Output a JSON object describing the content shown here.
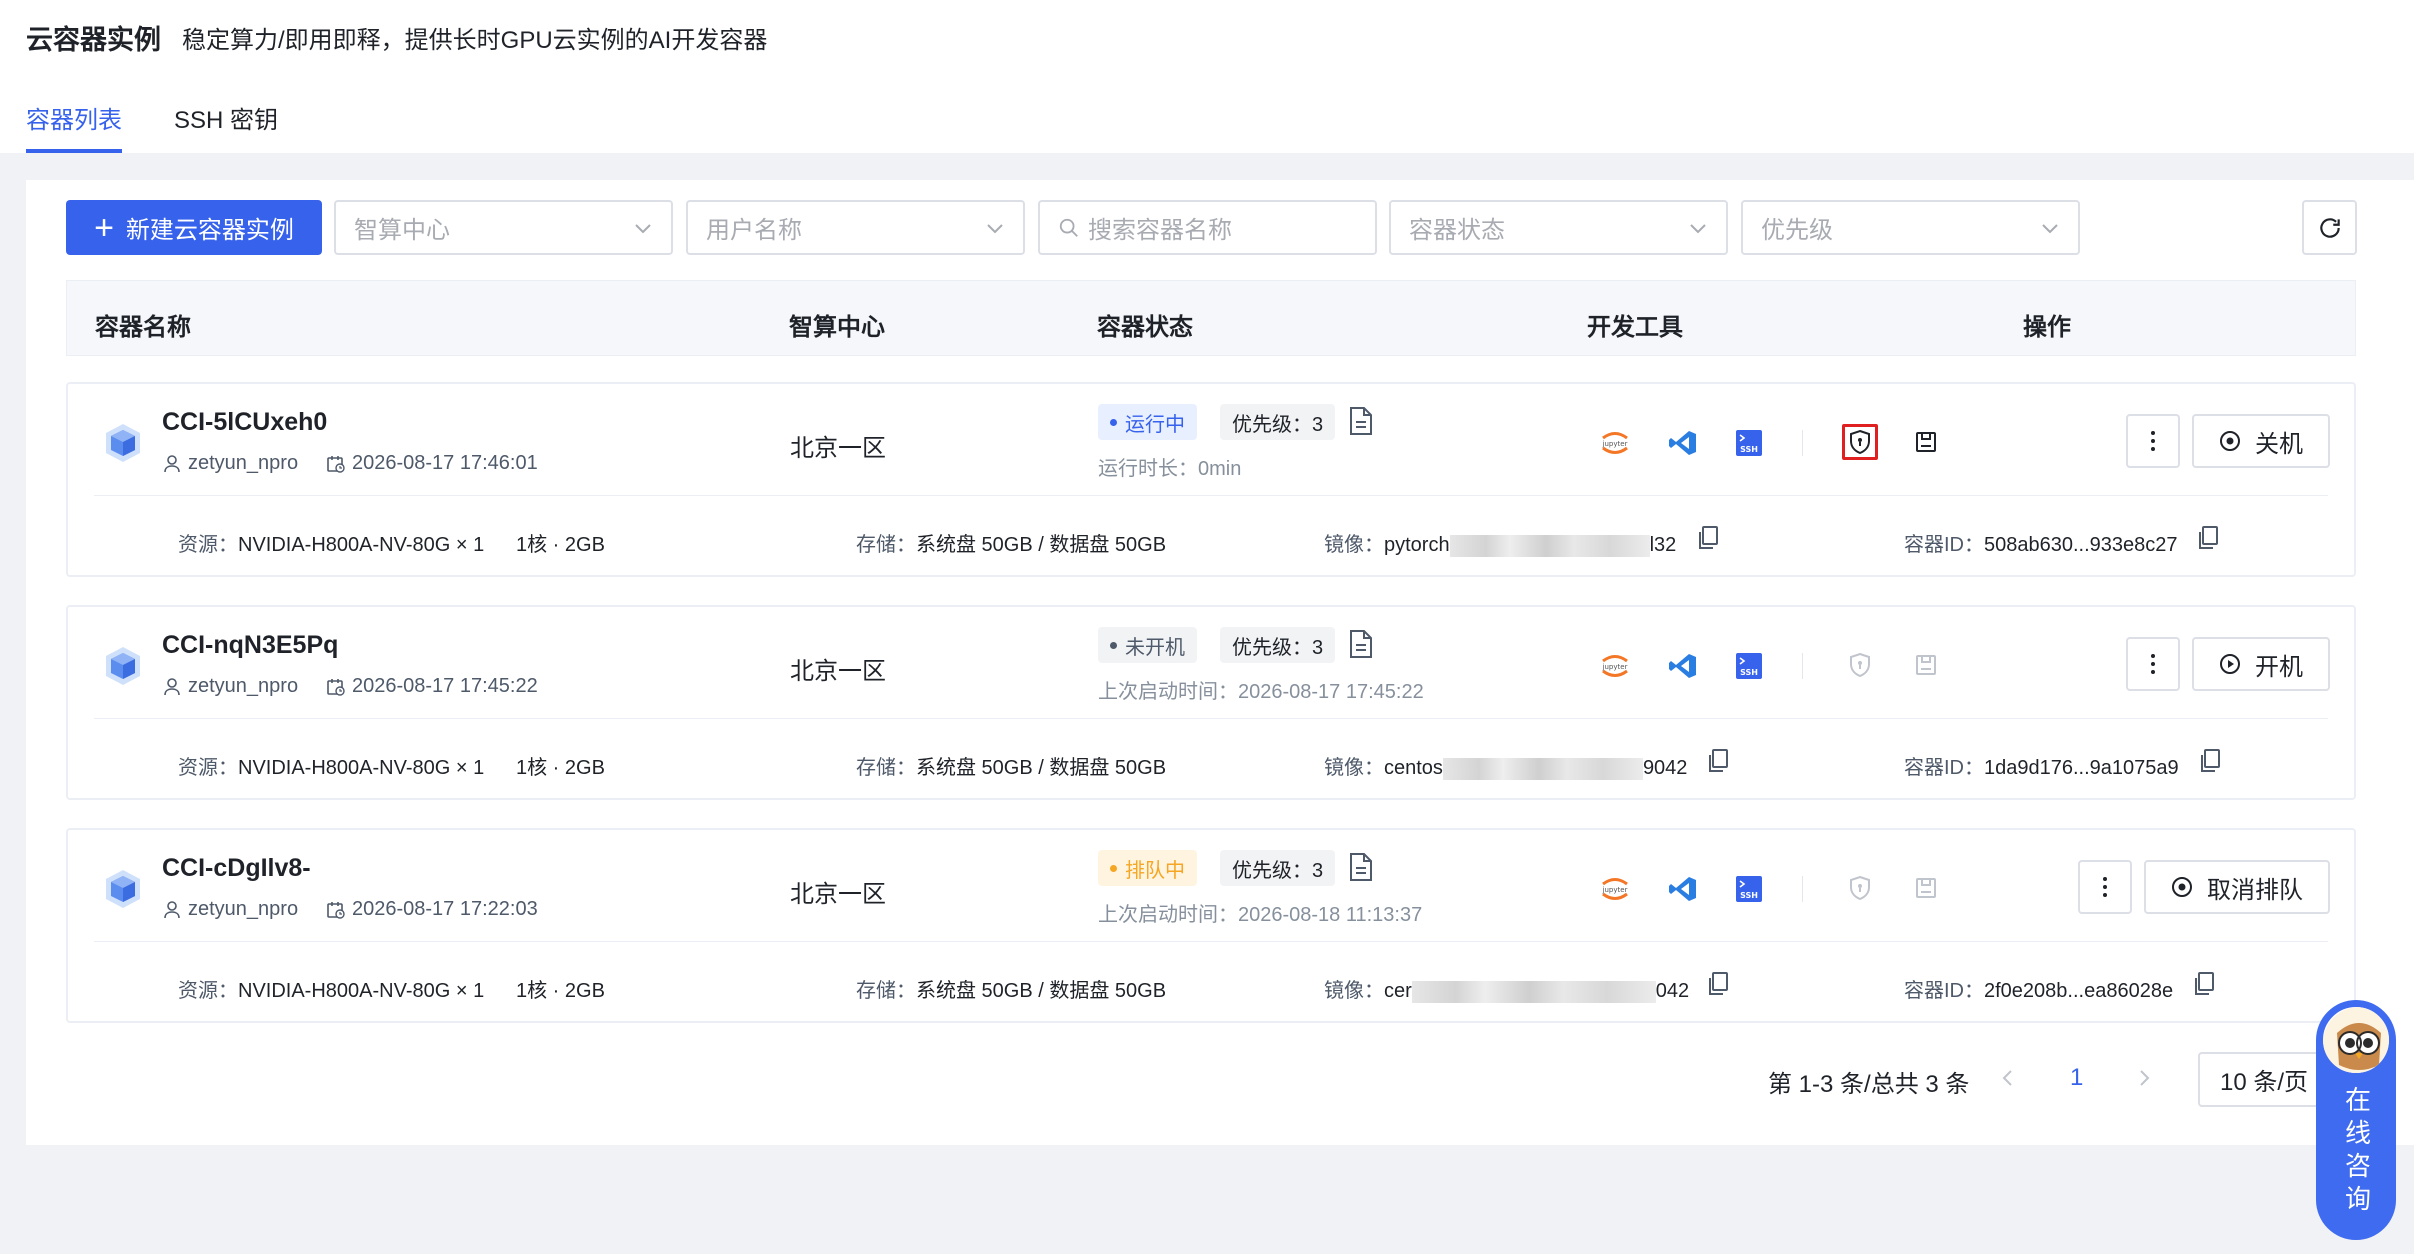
{
  "header": {
    "title": "云容器实例",
    "subtitle": "稳定算力/即用即释，提供长时GPU云实例的AI开发容器",
    "tabs": [
      {
        "label": "容器列表",
        "active": true
      },
      {
        "label": "SSH 密钥",
        "active": false
      }
    ]
  },
  "toolbar": {
    "create_label": "新建云容器实例",
    "filters": {
      "compute_center": "智算中心",
      "user_name": "用户名称",
      "search": "搜索容器名称",
      "status": "容器状态",
      "priority": "优先级"
    }
  },
  "table": {
    "columns": [
      "容器名称",
      "智算中心",
      "容器状态",
      "开发工具",
      "操作"
    ]
  },
  "containers": [
    {
      "name": "CCI-5lCUxeh0",
      "user": "zetyun_npro",
      "created": "2026-08-17 17:46:01",
      "center": "北京一区",
      "status": "运行中",
      "priority": "优先级：3",
      "status_sub": "运行时长：0min",
      "action": "关机",
      "resource_label": "资源：",
      "resource": "NVIDIA-H800A-NV-80G × 1",
      "spec": "1核 · 2GB",
      "storage_label": "存储：",
      "storage": "系统盘 50GB  /  数据盘 50GB",
      "image_label": "镜像：",
      "image_prefix": "pytorch",
      "image_suffix": "l32",
      "id_label": "容器ID：",
      "id": "508ab630...933e8c27"
    },
    {
      "name": "CCI-nqN3E5Pq",
      "user": "zetyun_npro",
      "created": "2026-08-17 17:45:22",
      "center": "北京一区",
      "status": "未开机",
      "priority": "优先级：3",
      "status_sub": "上次启动时间：2026-08-17 17:45:22",
      "action": "开机",
      "resource_label": "资源：",
      "resource": "NVIDIA-H800A-NV-80G × 1",
      "spec": "1核 · 2GB",
      "storage_label": "存储：",
      "storage": "系统盘 50GB  /  数据盘 50GB",
      "image_label": "镜像：",
      "image_prefix": "centos",
      "image_suffix": "9042",
      "id_label": "容器ID：",
      "id": "1da9d176...9a1075a9"
    },
    {
      "name": "CCI-cDgIlv8-",
      "user": "zetyun_npro",
      "created": "2026-08-17 17:22:03",
      "center": "北京一区",
      "status": "排队中",
      "priority": "优先级：3",
      "status_sub": "上次启动时间：2026-08-18 11:13:37",
      "action": "取消排队",
      "resource_label": "资源：",
      "resource": "NVIDIA-H800A-NV-80G × 1",
      "spec": "1核 · 2GB",
      "storage_label": "存储：",
      "storage": "系统盘 50GB  /  数据盘 50GB",
      "image_label": "镜像：",
      "image_prefix": "cer",
      "image_suffix": "042",
      "id_label": "容器ID：",
      "id": "2f0e208b...ea86028e"
    }
  ],
  "tool_labels": {
    "jupyter": "jupyter",
    "ssh": "SSH"
  },
  "pagination": {
    "total": "第 1-3 条/总共 3 条",
    "current": "1",
    "page_size": "10 条/页"
  },
  "consult": {
    "label": "在线咨询"
  },
  "colors": {
    "primary": "#3662ec",
    "running": "#3662ec",
    "stopped": "#4e5969",
    "queued": "#f5a623",
    "highlight": "#e02020"
  }
}
